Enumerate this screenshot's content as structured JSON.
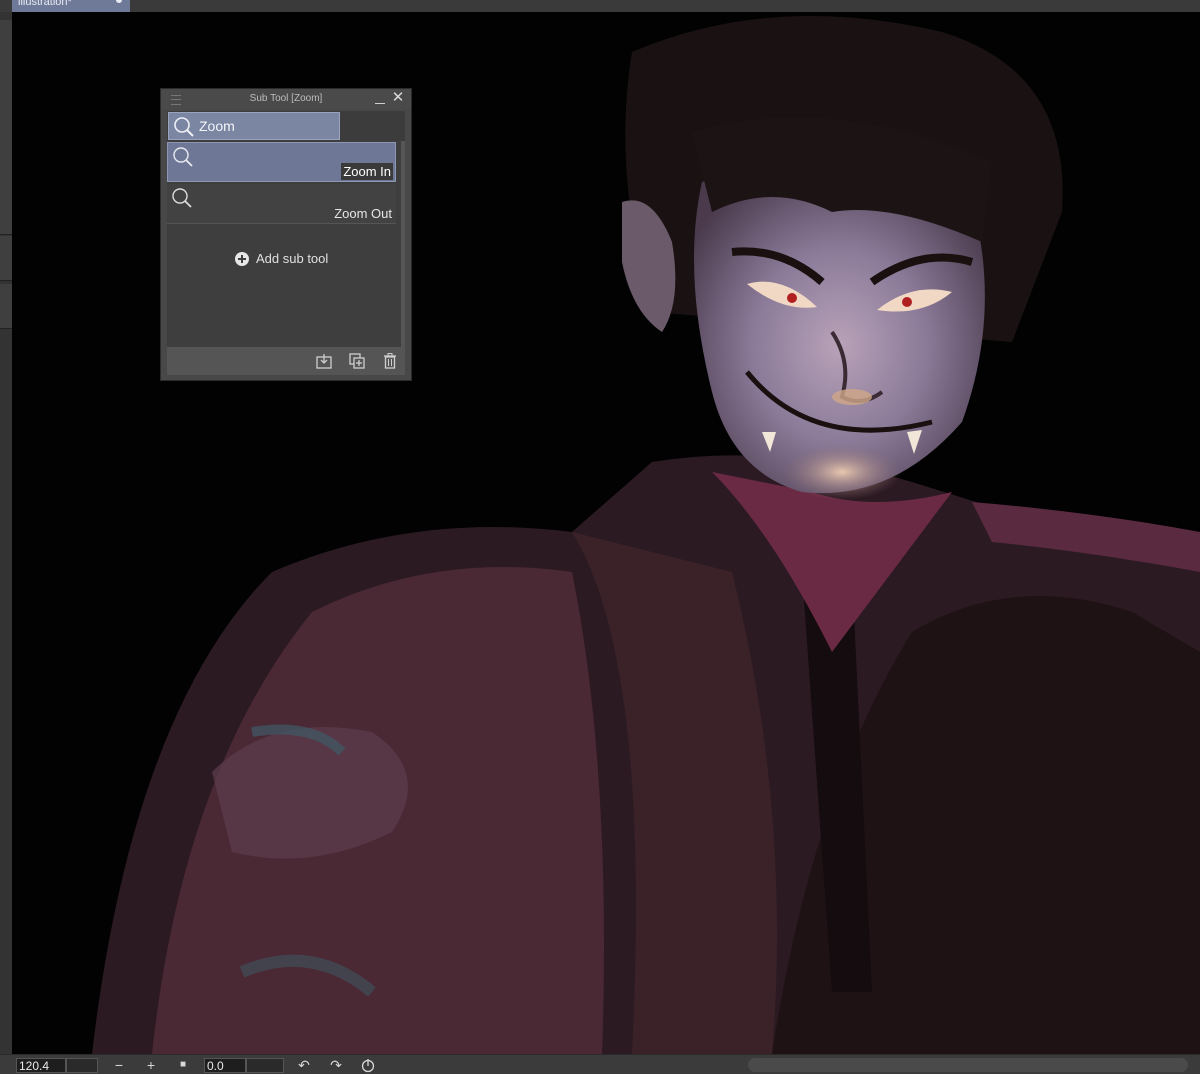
{
  "document_tab": {
    "label": "illustration*"
  },
  "subtool_panel": {
    "title": "Sub Tool [Zoom]",
    "group_tab": {
      "label": "Zoom",
      "icon": "magnifier-icon"
    },
    "items": [
      {
        "label": "Zoom In",
        "icon": "magnifier-icon",
        "selected": true
      },
      {
        "label": "Zoom Out",
        "icon": "magnifier-icon",
        "selected": false
      }
    ],
    "add_button_label": "Add sub tool",
    "footer_icons": [
      "import-icon",
      "duplicate-icon",
      "trash-icon"
    ]
  },
  "statusbar": {
    "zoom_value": "120.4",
    "rotation_value": "0.0",
    "zoom_out_symbol": "−",
    "zoom_in_symbol": "+",
    "fit_symbol": "■",
    "rotate_left_symbol": "↶",
    "rotate_right_symbol": "↷"
  },
  "colors": {
    "accent": "#7b86a3",
    "panel_bg": "#484848",
    "canvas_bg": "#000000"
  }
}
